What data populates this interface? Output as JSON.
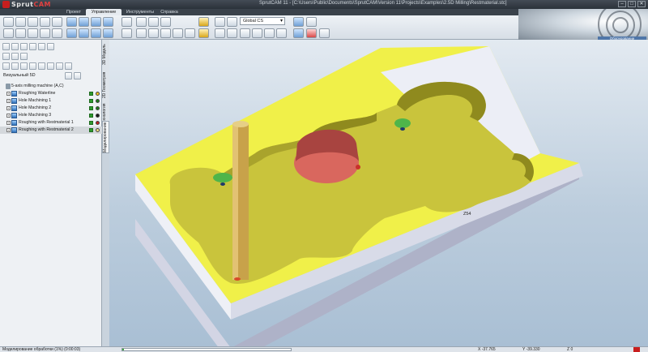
{
  "window": {
    "app_logo_prefix": "Sprut",
    "app_logo_suffix": "CAM",
    "title": "SprutCAM 11 - [C:\\Users\\Public\\Documents\\SprutCAM\\Version 11\\Projects\\Examples\\2.5D Milling\\Restmaterial.stc]",
    "minimize": "–",
    "maximize": "□",
    "close": "✕"
  },
  "ribbon": {
    "tabs": [
      "Проект",
      "Управление",
      "Инструменты",
      "Справка"
    ],
    "active_tab": "Управление",
    "coordinate_system": "Global CS"
  },
  "banner": {
    "label": "Оборудование"
  },
  "left_panel": {
    "mode_select": "Визуальный 5D",
    "tree": [
      {
        "label": "5-axis milling machine (A,C)",
        "type": "machine"
      },
      {
        "label": "Roughing Waterline",
        "checked": true,
        "status_color": "#f0c020"
      },
      {
        "label": "Hole Machining 1",
        "checked": true,
        "status_color": "#1a7a1a"
      },
      {
        "label": "Hole Machining 2",
        "checked": true,
        "status_color": "#1a7a1a"
      },
      {
        "label": "Hole Machining 3",
        "checked": true,
        "status_color": "#1a1a1a"
      },
      {
        "label": "Roughing with Restmaterial 1",
        "checked": true,
        "status_color": "#c02020"
      },
      {
        "label": "Roughing with Restmaterial 2",
        "checked": true,
        "status_color": "#f0e080",
        "selected": true
      }
    ],
    "vertical_tabs": [
      "3D Модель",
      "2D Геометрия",
      "Технология",
      "Моделирование"
    ]
  },
  "viewport": {
    "point_label": "Z54"
  },
  "colors": {
    "stock_top": "#f0f049",
    "stock_side_light": "#eceef6",
    "stock_side_dark": "#a8acc0",
    "pocket_floor": "#c9c43c",
    "pocket_wall": "#8f8a1e",
    "hole": "#d9675e",
    "tool_body": "#c8a24a",
    "tool_holder": "#4fb54a"
  },
  "status_bar": {
    "text": "Моделирование обработки (1%) (0:00:03)",
    "progress_pct": 1,
    "x": "X -37.765",
    "y": "Y -39.330",
    "z": "Z 0"
  }
}
